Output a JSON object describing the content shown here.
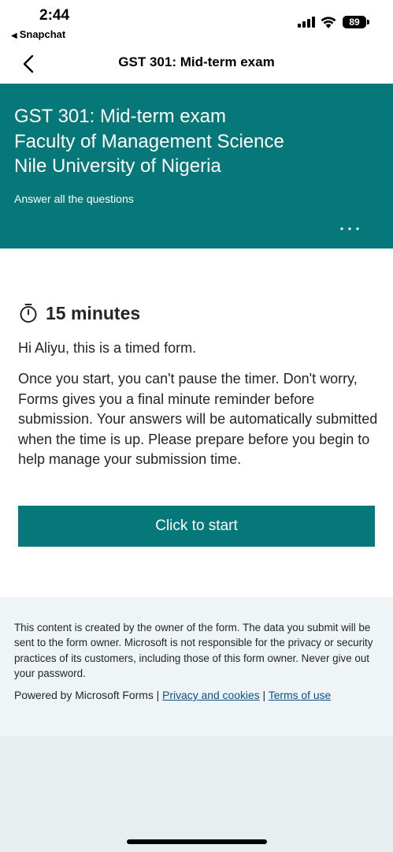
{
  "status_bar": {
    "time": "2:44",
    "back_app": "Snapchat",
    "battery": "89"
  },
  "nav": {
    "title": "GST 301: Mid-term exam"
  },
  "banner": {
    "title_lines": [
      "GST 301: Mid-term exam",
      "Faculty of Management Science",
      "Nile University of Nigeria"
    ],
    "description": "Answer all the questions",
    "background_color": "#077879"
  },
  "main": {
    "timer": "15 minutes",
    "greeting": "Hi Aliyu, this is a timed form.",
    "info": "Once you start, you can't pause the timer. Don't worry, Forms gives you a final minute reminder before submission. Your answers will be automatically submitted when the time is up. Please prepare before you begin to help manage your submission time.",
    "start_label": "Click to start"
  },
  "footer": {
    "disclaimer": "This content is created by the owner of the form. The data you submit will be sent to the form owner. Microsoft is not responsible for the privacy or security practices of its customers, including those of this form owner. Never give out your password.",
    "powered_by": "Powered by Microsoft Forms",
    "separator": "|",
    "privacy_link": "Privacy and cookies",
    "terms_link": "Terms of use"
  }
}
